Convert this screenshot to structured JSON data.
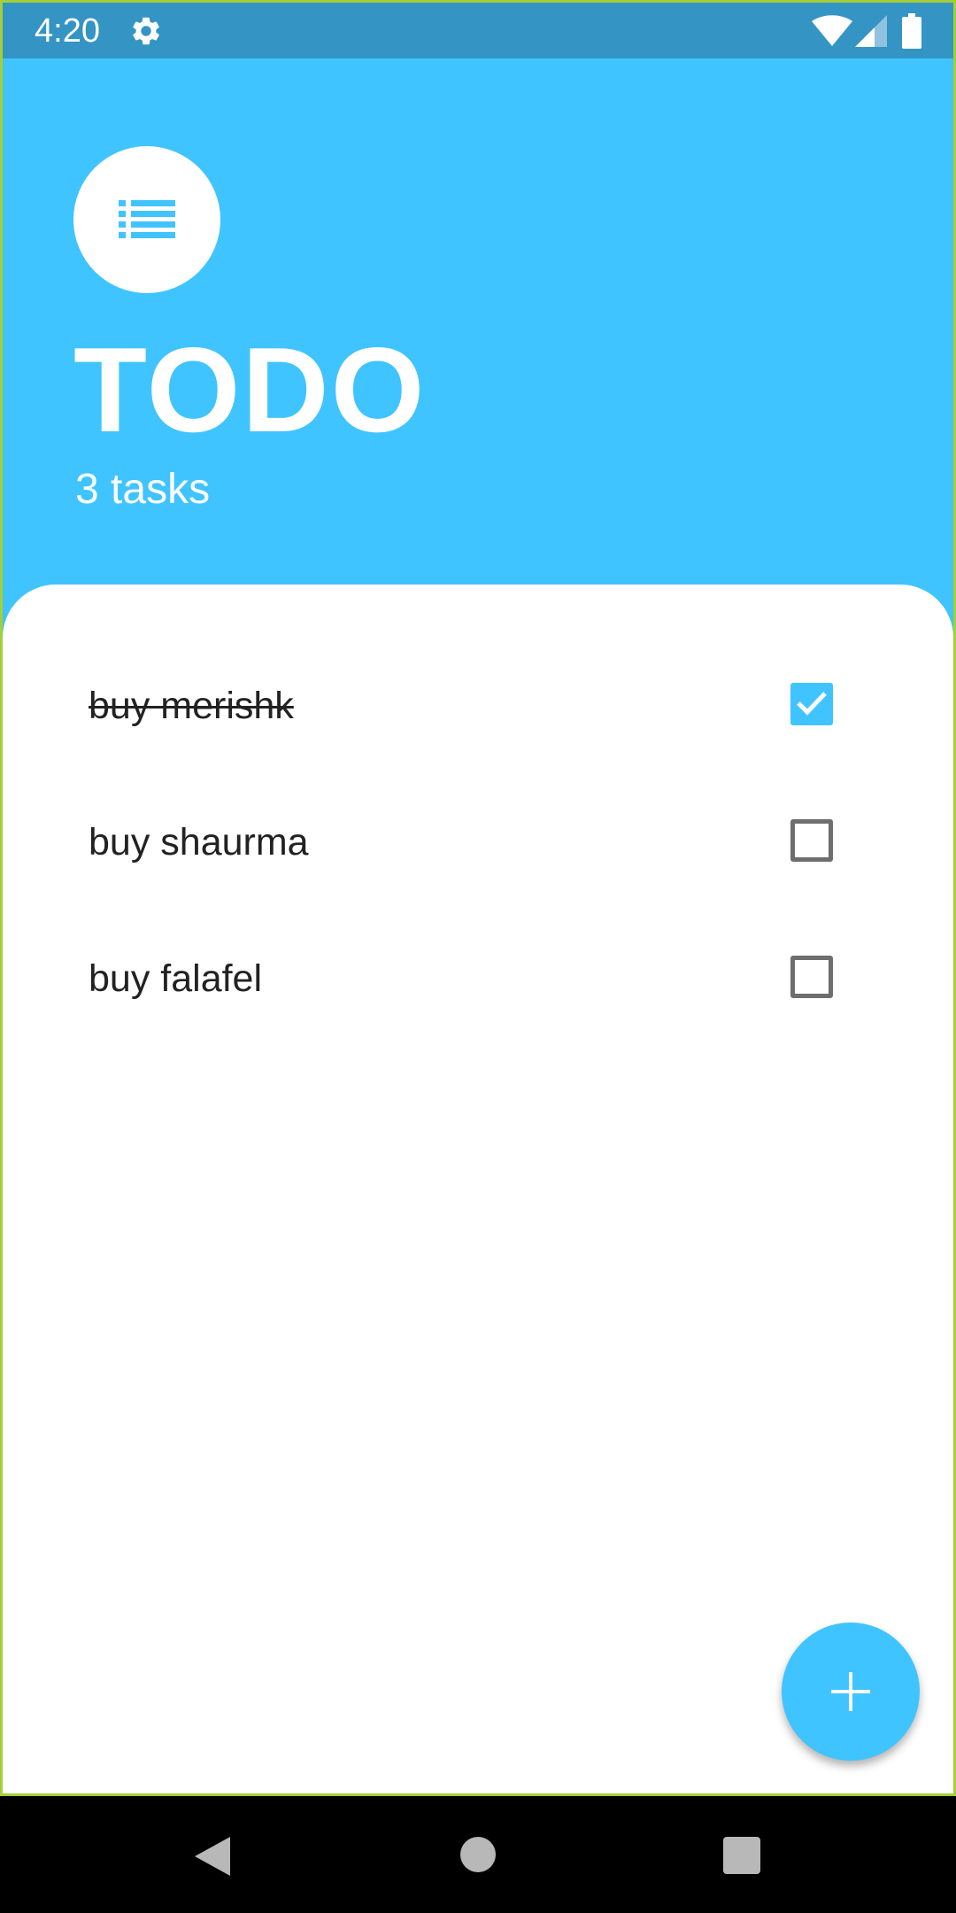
{
  "status_bar": {
    "time": "4:20",
    "icons": [
      "gear-icon",
      "wifi-icon",
      "signal-icon",
      "battery-icon"
    ]
  },
  "header": {
    "logo_icon": "list-icon",
    "title": "TODO",
    "task_count": "3 tasks"
  },
  "tasks": [
    {
      "label": "buy merishk",
      "checked": true
    },
    {
      "label": "buy shaurma",
      "checked": false
    },
    {
      "label": "buy falafel",
      "checked": false
    }
  ],
  "fab": {
    "icon": "plus-icon"
  },
  "nav_bar": {
    "icons": [
      "back-icon",
      "home-icon",
      "recents-icon"
    ]
  },
  "colors": {
    "primary": "#40c4ff",
    "status_bar": "#3494c4",
    "card": "#ffffff",
    "checkbox_border": "#6e6e6e"
  }
}
